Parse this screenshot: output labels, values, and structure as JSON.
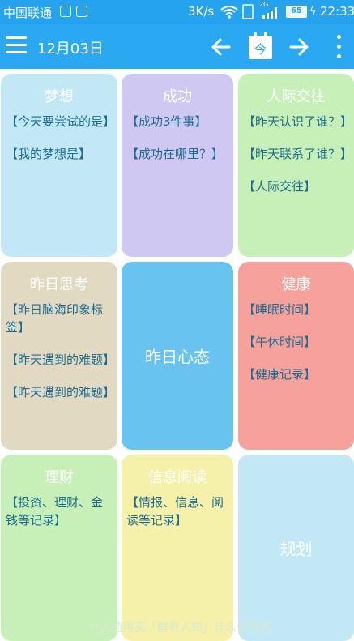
{
  "status_bar": {
    "carrier": "中国联通",
    "speed": "3K/s",
    "network_label": "2G",
    "battery": "65",
    "time": "22:33"
  },
  "toolbar": {
    "date": "12月03日",
    "today_label": "今"
  },
  "tiles": [
    {
      "title": "梦想",
      "items": [
        "【今天要尝试的是】",
        "【我的梦想是】"
      ],
      "color": "#c3e8f5"
    },
    {
      "title": "成功",
      "items": [
        "【成功3件事】",
        "【成功在哪里？】"
      ],
      "color": "#cfc8f2"
    },
    {
      "title": "人际交往",
      "items": [
        "【昨天认识了谁？】",
        "【昨天联系了谁？】",
        "【人际交往】"
      ],
      "color": "#c7f0b8"
    },
    {
      "title": "昨日思考",
      "items": [
        "【昨日脑海印象标签】",
        "【昨天遇到的难题】",
        "【昨天遇到的难题】"
      ],
      "color": "#e1d9c1"
    },
    {
      "title": "昨日心态",
      "items": [],
      "color": "#69c3f0"
    },
    {
      "title": "健康",
      "items": [
        "【睡眠时间】",
        "【午休时间】",
        "【健康记录】"
      ],
      "color": "#f6a19c"
    },
    {
      "title": "理财",
      "items": [
        "【投资、理财、金钱等记录】"
      ],
      "color": "#c7f0b8"
    },
    {
      "title": "信息阅读",
      "items": [
        "【情报、信息、阅读等记录】"
      ],
      "color": "#f5f0aa"
    },
    {
      "title": "规划",
      "items": [],
      "color": "#c3e8f5"
    }
  ],
  "watermark": "什么值得买「鲜有人知」什么值得买"
}
